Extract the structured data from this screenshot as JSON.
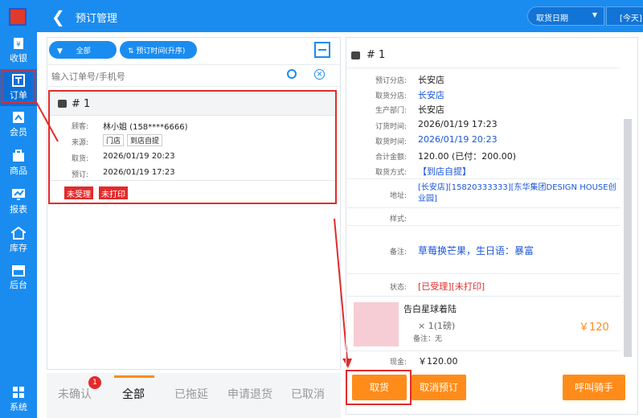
{
  "sidebar": {
    "items": [
      {
        "label": "收银",
        "icon": "cashier-icon"
      },
      {
        "label": "订单",
        "icon": "order-icon"
      },
      {
        "label": "会员",
        "icon": "member-icon"
      },
      {
        "label": "商品",
        "icon": "product-icon"
      },
      {
        "label": "报表",
        "icon": "report-icon"
      },
      {
        "label": "库存",
        "icon": "inventory-icon"
      },
      {
        "label": "后台",
        "icon": "backend-icon"
      },
      {
        "label": "系统",
        "icon": "system-icon"
      }
    ],
    "active_index": 1
  },
  "header": {
    "title": "预订管理",
    "sort_select": "取货日期",
    "date_button": "[今天]"
  },
  "filters": {
    "all_chip": "全部",
    "sort_chip": "预订时间(升序)"
  },
  "search": {
    "placeholder": "输入订单号/手机号"
  },
  "order_card": {
    "number": "# 1",
    "rows": [
      {
        "key": "顾客:",
        "value": "林小姐 (158****6666)"
      },
      {
        "key": "来源:",
        "tags": [
          "门店",
          "到店自提"
        ]
      },
      {
        "key": "取货:",
        "value": "2026/01/19 20:23"
      },
      {
        "key": "预订:",
        "value": "2026/01/19 17:23"
      }
    ],
    "badges": [
      "未受理",
      "未打印"
    ]
  },
  "bottom_tabs": {
    "items": [
      "未确认",
      "全部",
      "已拖延",
      "申请退货",
      "已取消"
    ],
    "active_index": 1,
    "unconfirmed_count": "1"
  },
  "detail": {
    "number": "# 1",
    "fields": [
      {
        "key": "预订分店:",
        "value": "长安店"
      },
      {
        "key": "取货分店:",
        "value": "长安店"
      },
      {
        "key": "生产部门:",
        "value": "长安店"
      },
      {
        "key": "订货时间:",
        "value": "2026/01/19 17:23"
      },
      {
        "key": "取货时间:",
        "value": "2026/01/19 20:23"
      },
      {
        "key": "合计金额:",
        "value": "120.00  (已付：200.00)"
      },
      {
        "key": "取货方式:",
        "value": "【到店自提】"
      },
      {
        "key": "地址:",
        "value": "[长安店][15820333333][东华集团DESIGN HOUSE创业园]"
      },
      {
        "key": "样式:",
        "value": ""
      },
      {
        "key": "备注:",
        "value": "草莓换芒果，生日语：暴富"
      },
      {
        "key": "状态:",
        "value": "[已受理][未打印]"
      }
    ],
    "product": {
      "name": "告白星球着陆",
      "qty": "× 1(1磅)",
      "note": "备注：无",
      "price": "￥120"
    },
    "payment_key": "现金:",
    "payment_value": "￥120.00"
  },
  "actions": {
    "pickup": "取货",
    "cancel": "取消预订",
    "call_rider": "呼叫骑手"
  },
  "colors": {
    "primary": "#1a8cf0",
    "accent": "#ff8c1a",
    "highlight": "#e32b2b"
  }
}
